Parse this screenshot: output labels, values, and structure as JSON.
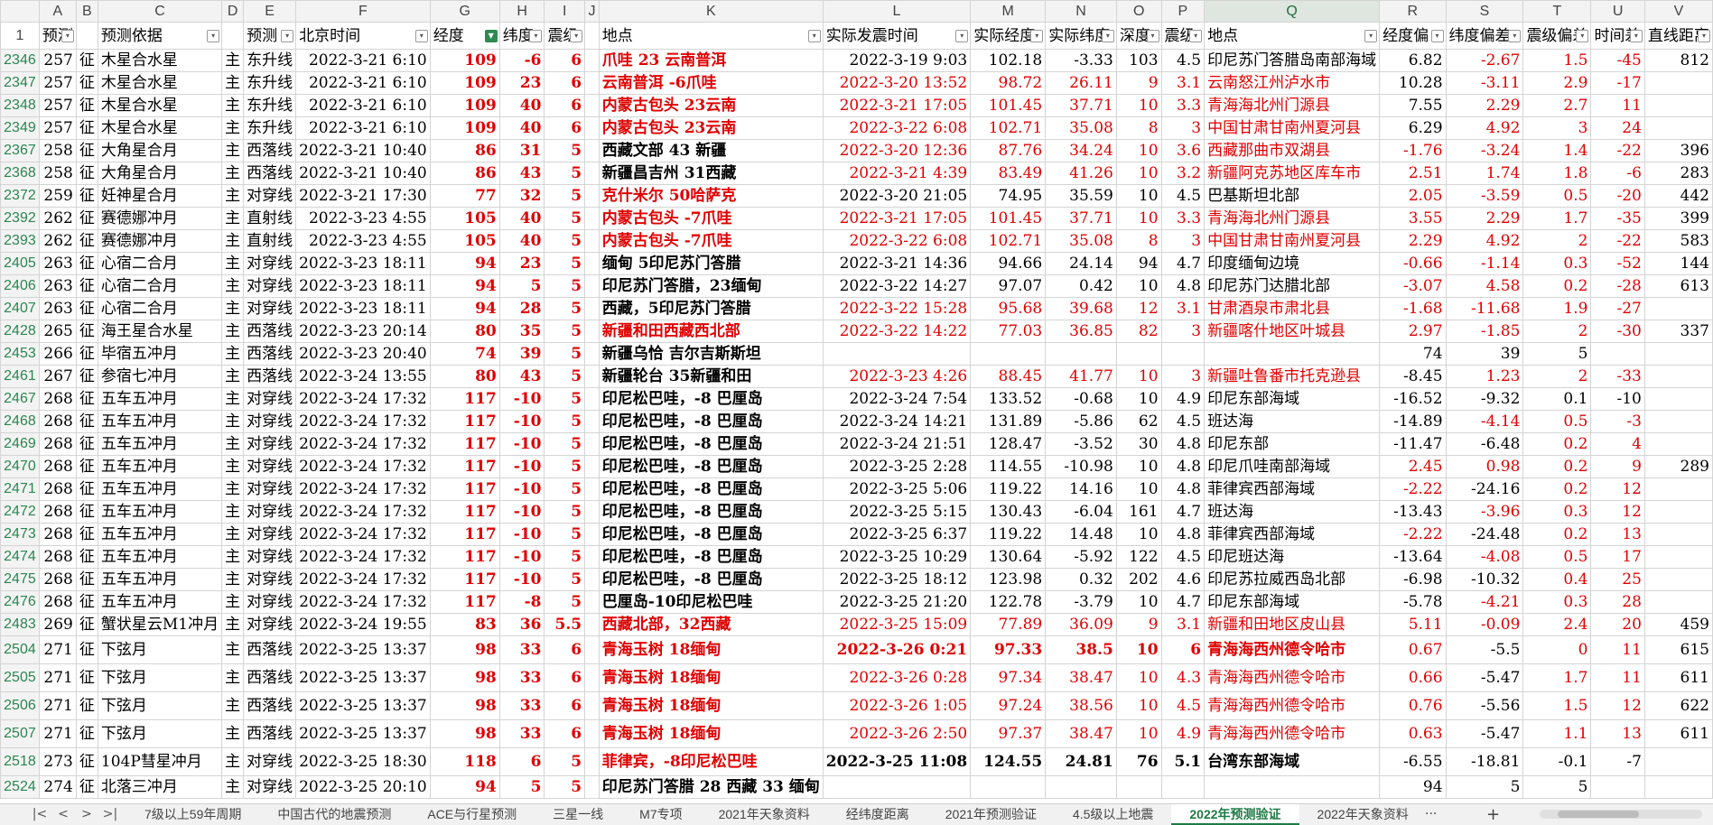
{
  "columns": [
    {
      "letter": "A",
      "header": "预测"
    },
    {
      "letter": "B",
      "header": ""
    },
    {
      "letter": "C",
      "header": "预测依据"
    },
    {
      "letter": "D",
      "header": ""
    },
    {
      "letter": "E",
      "header": "预测"
    },
    {
      "letter": "F",
      "header": "北京时间"
    },
    {
      "letter": "G",
      "header": "经度"
    },
    {
      "letter": "H",
      "header": "纬度"
    },
    {
      "letter": "I",
      "header": "震级"
    },
    {
      "letter": "J",
      "header": ""
    },
    {
      "letter": "K",
      "header": "地点"
    },
    {
      "letter": "L",
      "header": "实际发震时间"
    },
    {
      "letter": "M",
      "header": "实际经度"
    },
    {
      "letter": "N",
      "header": "实际纬度"
    },
    {
      "letter": "O",
      "header": "深度"
    },
    {
      "letter": "P",
      "header": "震级"
    },
    {
      "letter": "Q",
      "header": "地点"
    },
    {
      "letter": "R",
      "header": "经度偏"
    },
    {
      "letter": "S",
      "header": "纬度偏差"
    },
    {
      "letter": "T",
      "header": "震级偏差"
    },
    {
      "letter": "U",
      "header": "时间差"
    },
    {
      "letter": "V",
      "header": "直线距离"
    }
  ],
  "corner": "",
  "header_row": "1",
  "rows": [
    {
      "rn": "2346",
      "A": "257",
      "B": "征",
      "C": "木星合水星",
      "D": "主",
      "E": "东升线",
      "F": "2022-3-21  6:10",
      "G": "109",
      "H": "-6",
      "I": "6",
      "J": "",
      "K": "爪哇  23  云南普洱",
      "L": "2022-3-19  9:03",
      "M": "102.18",
      "N": "-3.33",
      "O": "103",
      "P": "4.5",
      "Q": "印尼苏门答腊岛南部海域",
      "R": "6.82",
      "S": "-2.67",
      "T": "1.5",
      "U": "-45",
      "V": "812",
      "kr": 1,
      "lr": 0,
      "qr": 0,
      "rr": 0,
      "sr": 1,
      "tr": 1,
      "ur": 1
    },
    {
      "rn": "2347",
      "A": "257",
      "B": "征",
      "C": "木星合水星",
      "D": "主",
      "E": "东升线",
      "F": "2022-3-21  6:10",
      "G": "109",
      "H": "23",
      "I": "6",
      "J": "",
      "K": "云南普洱  -6爪哇",
      "L": "2022-3-20  13:52",
      "M": "98.72",
      "N": "26.11",
      "O": "9",
      "P": "3.1",
      "Q": "云南怒江州泸水市",
      "R": "10.28",
      "S": "-3.11",
      "T": "2.9",
      "U": "-17",
      "V": "",
      "kr": 1,
      "lr": 1,
      "qr": 1,
      "rr": 0,
      "sr": 1,
      "tr": 1,
      "ur": 1
    },
    {
      "rn": "2348",
      "A": "257",
      "B": "征",
      "C": "木星合水星",
      "D": "主",
      "E": "东升线",
      "F": "2022-3-21  6:10",
      "G": "109",
      "H": "40",
      "I": "6",
      "J": "",
      "K": "内蒙古包头  23云南",
      "L": "2022-3-21  17:05",
      "M": "101.45",
      "N": "37.71",
      "O": "10",
      "P": "3.3",
      "Q": "青海海北州门源县",
      "R": "7.55",
      "S": "2.29",
      "T": "2.7",
      "U": "11",
      "V": "",
      "kr": 1,
      "lr": 1,
      "qr": 1,
      "rr": 0,
      "sr": 1,
      "tr": 1,
      "ur": 1
    },
    {
      "rn": "2349",
      "A": "257",
      "B": "征",
      "C": "木星合水星",
      "D": "主",
      "E": "东升线",
      "F": "2022-3-21  6:10",
      "G": "109",
      "H": "40",
      "I": "6",
      "J": "",
      "K": "内蒙古包头  23云南",
      "L": "2022-3-22  6:08",
      "M": "102.71",
      "N": "35.08",
      "O": "8",
      "P": "3",
      "Q": "中国甘肃甘南州夏河县",
      "R": "6.29",
      "S": "4.92",
      "T": "3",
      "U": "24",
      "V": "",
      "kr": 1,
      "lr": 1,
      "qr": 1,
      "rr": 0,
      "sr": 1,
      "tr": 1,
      "ur": 1
    },
    {
      "rn": "2367",
      "A": "258",
      "B": "征",
      "C": "大角星合月",
      "D": "主",
      "E": "西落线",
      "F": "2022-3-21  10:40",
      "G": "86",
      "H": "31",
      "I": "5",
      "J": "",
      "K": "西藏文部  43  新疆",
      "L": "2022-3-20  12:36",
      "M": "87.76",
      "N": "34.24",
      "O": "10",
      "P": "3.6",
      "Q": "西藏那曲市双湖县",
      "R": "-1.76",
      "S": "-3.24",
      "T": "1.4",
      "U": "-22",
      "V": "396",
      "kr": 0,
      "lr": 1,
      "qr": 1,
      "rr": 1,
      "sr": 1,
      "tr": 1,
      "ur": 1
    },
    {
      "rn": "2368",
      "A": "258",
      "B": "征",
      "C": "大角星合月",
      "D": "主",
      "E": "西落线",
      "F": "2022-3-21  10:40",
      "G": "86",
      "H": "43",
      "I": "5",
      "J": "",
      "K": "新疆昌吉州  31西藏",
      "L": "2022-3-21  4:39",
      "M": "83.49",
      "N": "41.26",
      "O": "10",
      "P": "3.2",
      "Q": "新疆阿克苏地区库车市",
      "R": "2.51",
      "S": "1.74",
      "T": "1.8",
      "U": "-6",
      "V": "283",
      "kr": 0,
      "lr": 1,
      "qr": 1,
      "rr": 1,
      "sr": 1,
      "tr": 1,
      "ur": 1
    },
    {
      "rn": "2372",
      "A": "259",
      "B": "征",
      "C": "妊神星合月",
      "D": "主",
      "E": "对穿线",
      "F": "2022-3-21  17:30",
      "G": "77",
      "H": "32",
      "I": "5",
      "J": "",
      "K": "克什米尔  50哈萨克",
      "L": "2022-3-20  21:05",
      "M": "74.95",
      "N": "35.59",
      "O": "10",
      "P": "4.5",
      "Q": "巴基斯坦北部",
      "R": "2.05",
      "S": "-3.59",
      "T": "0.5",
      "U": "-20",
      "V": "442",
      "kr": 1,
      "lr": 0,
      "qr": 0,
      "rr": 1,
      "sr": 1,
      "tr": 1,
      "ur": 1
    },
    {
      "rn": "2392",
      "A": "262",
      "B": "征",
      "C": "赛德娜冲月",
      "D": "主",
      "E": "直射线",
      "F": "2022-3-23  4:55",
      "G": "105",
      "H": "40",
      "I": "5",
      "J": "",
      "K": "内蒙古包头  -7爪哇",
      "L": "2022-3-21  17:05",
      "M": "101.45",
      "N": "37.71",
      "O": "10",
      "P": "3.3",
      "Q": "青海海北州门源县",
      "R": "3.55",
      "S": "2.29",
      "T": "1.7",
      "U": "-35",
      "V": "399",
      "kr": 1,
      "lr": 1,
      "qr": 1,
      "rr": 1,
      "sr": 1,
      "tr": 1,
      "ur": 1
    },
    {
      "rn": "2393",
      "A": "262",
      "B": "征",
      "C": "赛德娜冲月",
      "D": "主",
      "E": "直射线",
      "F": "2022-3-23  4:55",
      "G": "105",
      "H": "40",
      "I": "5",
      "J": "",
      "K": "内蒙古包头  -7爪哇",
      "L": "2022-3-22  6:08",
      "M": "102.71",
      "N": "35.08",
      "O": "8",
      "P": "3",
      "Q": "中国甘肃甘南州夏河县",
      "R": "2.29",
      "S": "4.92",
      "T": "2",
      "U": "-22",
      "V": "583",
      "kr": 1,
      "lr": 1,
      "qr": 1,
      "rr": 1,
      "sr": 1,
      "tr": 1,
      "ur": 1
    },
    {
      "rn": "2405",
      "A": "263",
      "B": "征",
      "C": "心宿二合月",
      "D": "主",
      "E": "对穿线",
      "F": "2022-3-23  18:11",
      "G": "94",
      "H": "23",
      "I": "5",
      "J": "",
      "K": "缅甸  5印尼苏门答腊",
      "L": "2022-3-21  14:36",
      "M": "94.66",
      "N": "24.14",
      "O": "94",
      "P": "4.7",
      "Q": "印度缅甸边境",
      "R": "-0.66",
      "S": "-1.14",
      "T": "0.3",
      "U": "-52",
      "V": "144",
      "kr": 0,
      "lr": 0,
      "qr": 0,
      "rr": 1,
      "sr": 1,
      "tr": 1,
      "ur": 1
    },
    {
      "rn": "2406",
      "A": "263",
      "B": "征",
      "C": "心宿二合月",
      "D": "主",
      "E": "对穿线",
      "F": "2022-3-23  18:11",
      "G": "94",
      "H": "5",
      "I": "5",
      "J": "",
      "K": "印尼苏门答腊，23缅甸",
      "L": "2022-3-22  14:27",
      "M": "97.07",
      "N": "0.42",
      "O": "10",
      "P": "4.8",
      "Q": "印尼苏门达腊北部",
      "R": "-3.07",
      "S": "4.58",
      "T": "0.2",
      "U": "-28",
      "V": "613",
      "kr": 0,
      "lr": 0,
      "qr": 0,
      "rr": 1,
      "sr": 1,
      "tr": 1,
      "ur": 1
    },
    {
      "rn": "2407",
      "A": "263",
      "B": "征",
      "C": "心宿二合月",
      "D": "主",
      "E": "对穿线",
      "F": "2022-3-23  18:11",
      "G": "94",
      "H": "28",
      "I": "5",
      "J": "",
      "K": "西藏，5印尼苏门答腊",
      "L": "2022-3-22  15:28",
      "M": "95.68",
      "N": "39.68",
      "O": "12",
      "P": "3.1",
      "Q": "甘肃酒泉市肃北县",
      "R": "-1.68",
      "S": "-11.68",
      "T": "1.9",
      "U": "-27",
      "V": "",
      "kr": 0,
      "lr": 1,
      "qr": 1,
      "rr": 1,
      "sr": 1,
      "tr": 1,
      "ur": 1
    },
    {
      "rn": "2428",
      "A": "265",
      "B": "征",
      "C": "海王星合水星",
      "D": "主",
      "E": "西落线",
      "F": "2022-3-23  20:14",
      "G": "80",
      "H": "35",
      "I": "5",
      "J": "",
      "K": "新疆和田西藏西北部",
      "L": "2022-3-22  14:22",
      "M": "77.03",
      "N": "36.85",
      "O": "82",
      "P": "3",
      "Q": "新疆喀什地区叶城县",
      "R": "2.97",
      "S": "-1.85",
      "T": "2",
      "U": "-30",
      "V": "337",
      "kr": 1,
      "lr": 1,
      "qr": 1,
      "rr": 1,
      "sr": 1,
      "tr": 1,
      "ur": 1
    },
    {
      "rn": "2453",
      "A": "266",
      "B": "征",
      "C": "毕宿五冲月",
      "D": "主",
      "E": "西落线",
      "F": "2022-3-23  20:40",
      "G": "74",
      "H": "39",
      "I": "5",
      "J": "",
      "K": "新疆乌恰  吉尔吉斯斯坦",
      "L": "",
      "M": "",
      "N": "",
      "O": "",
      "P": "",
      "Q": "",
      "R": "74",
      "S": "39",
      "T": "5",
      "U": "",
      "V": "",
      "kr": 0,
      "lr": 0,
      "qr": 0,
      "rr": 0,
      "sr": 0,
      "tr": 0,
      "ur": 0
    },
    {
      "rn": "2461",
      "A": "267",
      "B": "征",
      "C": "参宿七冲月",
      "D": "主",
      "E": "西落线",
      "F": "2022-3-24  13:55",
      "G": "80",
      "H": "43",
      "I": "5",
      "J": "",
      "K": "新疆轮台  35新疆和田",
      "L": "2022-3-23  4:26",
      "M": "88.45",
      "N": "41.77",
      "O": "10",
      "P": "3",
      "Q": "新疆吐鲁番市托克逊县",
      "R": "-8.45",
      "S": "1.23",
      "T": "2",
      "U": "-33",
      "V": "",
      "kr": 0,
      "lr": 1,
      "qr": 1,
      "rr": 0,
      "sr": 1,
      "tr": 1,
      "ur": 1
    },
    {
      "rn": "2467",
      "A": "268",
      "B": "征",
      "C": "五车五冲月",
      "D": "主",
      "E": "对穿线",
      "F": "2022-3-24  17:32",
      "G": "117",
      "H": "-10",
      "I": "5",
      "J": "",
      "K": "印尼松巴哇，-8  巴厘岛",
      "L": "2022-3-24  7:54",
      "M": "133.52",
      "N": "-0.68",
      "O": "10",
      "P": "4.9",
      "Q": "印尼东部海域",
      "R": "-16.52",
      "S": "-9.32",
      "T": "0.1",
      "U": "-10",
      "V": "",
      "kr": 0,
      "lr": 0,
      "qr": 0,
      "rr": 0,
      "sr": 0,
      "tr": 0,
      "ur": 0
    },
    {
      "rn": "2468",
      "A": "268",
      "B": "征",
      "C": "五车五冲月",
      "D": "主",
      "E": "对穿线",
      "F": "2022-3-24  17:32",
      "G": "117",
      "H": "-10",
      "I": "5",
      "J": "",
      "K": "印尼松巴哇，-8  巴厘岛",
      "L": "2022-3-24  14:21",
      "M": "131.89",
      "N": "-5.86",
      "O": "62",
      "P": "4.5",
      "Q": "班达海",
      "R": "-14.89",
      "S": "-4.14",
      "T": "0.5",
      "U": "-3",
      "V": "",
      "kr": 0,
      "lr": 0,
      "qr": 0,
      "rr": 0,
      "sr": 1,
      "tr": 1,
      "ur": 1
    },
    {
      "rn": "2469",
      "A": "268",
      "B": "征",
      "C": "五车五冲月",
      "D": "主",
      "E": "对穿线",
      "F": "2022-3-24  17:32",
      "G": "117",
      "H": "-10",
      "I": "5",
      "J": "",
      "K": "印尼松巴哇，-8  巴厘岛",
      "L": "2022-3-24  21:51",
      "M": "128.47",
      "N": "-3.52",
      "O": "30",
      "P": "4.8",
      "Q": "印尼东部",
      "R": "-11.47",
      "S": "-6.48",
      "T": "0.2",
      "U": "4",
      "V": "",
      "kr": 0,
      "lr": 0,
      "qr": 0,
      "rr": 0,
      "sr": 0,
      "tr": 1,
      "ur": 1
    },
    {
      "rn": "2470",
      "A": "268",
      "B": "征",
      "C": "五车五冲月",
      "D": "主",
      "E": "对穿线",
      "F": "2022-3-24  17:32",
      "G": "117",
      "H": "-10",
      "I": "5",
      "J": "",
      "K": "印尼松巴哇，-8  巴厘岛",
      "L": "2022-3-25  2:28",
      "M": "114.55",
      "N": "-10.98",
      "O": "10",
      "P": "4.8",
      "Q": "印尼爪哇南部海域",
      "R": "2.45",
      "S": "0.98",
      "T": "0.2",
      "U": "9",
      "V": "289",
      "kr": 0,
      "lr": 0,
      "qr": 0,
      "rr": 1,
      "sr": 1,
      "tr": 1,
      "ur": 1
    },
    {
      "rn": "2471",
      "A": "268",
      "B": "征",
      "C": "五车五冲月",
      "D": "主",
      "E": "对穿线",
      "F": "2022-3-24  17:32",
      "G": "117",
      "H": "-10",
      "I": "5",
      "J": "",
      "K": "印尼松巴哇，-8  巴厘岛",
      "L": "2022-3-25  5:06",
      "M": "119.22",
      "N": "14.16",
      "O": "10",
      "P": "4.8",
      "Q": "菲律宾西部海域",
      "R": "-2.22",
      "S": "-24.16",
      "T": "0.2",
      "U": "12",
      "V": "",
      "kr": 0,
      "lr": 0,
      "qr": 0,
      "rr": 1,
      "sr": 0,
      "tr": 1,
      "ur": 1
    },
    {
      "rn": "2472",
      "A": "268",
      "B": "征",
      "C": "五车五冲月",
      "D": "主",
      "E": "对穿线",
      "F": "2022-3-24  17:32",
      "G": "117",
      "H": "-10",
      "I": "5",
      "J": "",
      "K": "印尼松巴哇，-8  巴厘岛",
      "L": "2022-3-25  5:15",
      "M": "130.43",
      "N": "-6.04",
      "O": "161",
      "P": "4.7",
      "Q": "班达海",
      "R": "-13.43",
      "S": "-3.96",
      "T": "0.3",
      "U": "12",
      "V": "",
      "kr": 0,
      "lr": 0,
      "qr": 0,
      "rr": 0,
      "sr": 1,
      "tr": 1,
      "ur": 1
    },
    {
      "rn": "2473",
      "A": "268",
      "B": "征",
      "C": "五车五冲月",
      "D": "主",
      "E": "对穿线",
      "F": "2022-3-24  17:32",
      "G": "117",
      "H": "-10",
      "I": "5",
      "J": "",
      "K": "印尼松巴哇，-8  巴厘岛",
      "L": "2022-3-25  6:37",
      "M": "119.22",
      "N": "14.48",
      "O": "10",
      "P": "4.8",
      "Q": "菲律宾西部海域",
      "R": "-2.22",
      "S": "-24.48",
      "T": "0.2",
      "U": "13",
      "V": "",
      "kr": 0,
      "lr": 0,
      "qr": 0,
      "rr": 1,
      "sr": 0,
      "tr": 1,
      "ur": 1
    },
    {
      "rn": "2474",
      "A": "268",
      "B": "征",
      "C": "五车五冲月",
      "D": "主",
      "E": "对穿线",
      "F": "2022-3-24  17:32",
      "G": "117",
      "H": "-10",
      "I": "5",
      "J": "",
      "K": "印尼松巴哇，-8  巴厘岛",
      "L": "2022-3-25  10:29",
      "M": "130.64",
      "N": "-5.92",
      "O": "122",
      "P": "4.5",
      "Q": "印尼班达海",
      "R": "-13.64",
      "S": "-4.08",
      "T": "0.5",
      "U": "17",
      "V": "",
      "kr": 0,
      "lr": 0,
      "qr": 0,
      "rr": 0,
      "sr": 1,
      "tr": 1,
      "ur": 1
    },
    {
      "rn": "2475",
      "A": "268",
      "B": "征",
      "C": "五车五冲月",
      "D": "主",
      "E": "对穿线",
      "F": "2022-3-24  17:32",
      "G": "117",
      "H": "-10",
      "I": "5",
      "J": "",
      "K": "印尼松巴哇，-8  巴厘岛",
      "L": "2022-3-25  18:12",
      "M": "123.98",
      "N": "0.32",
      "O": "202",
      "P": "4.6",
      "Q": "印尼苏拉威西岛北部",
      "R": "-6.98",
      "S": "-10.32",
      "T": "0.4",
      "U": "25",
      "V": "",
      "kr": 0,
      "lr": 0,
      "qr": 0,
      "rr": 0,
      "sr": 0,
      "tr": 1,
      "ur": 1
    },
    {
      "rn": "2476",
      "A": "268",
      "B": "征",
      "C": "五车五冲月",
      "D": "主",
      "E": "对穿线",
      "F": "2022-3-24  17:32",
      "G": "117",
      "H": "-8",
      "I": "5",
      "J": "",
      "K": "巴厘岛-10印尼松巴哇",
      "L": "2022-3-25  21:20",
      "M": "122.78",
      "N": "-3.79",
      "O": "10",
      "P": "4.7",
      "Q": "印尼东部海域",
      "R": "-5.78",
      "S": "-4.21",
      "T": "0.3",
      "U": "28",
      "V": "",
      "kr": 0,
      "lr": 0,
      "qr": 0,
      "rr": 0,
      "sr": 1,
      "tr": 1,
      "ur": 1
    },
    {
      "rn": "2483",
      "A": "269",
      "B": "征",
      "C": "蟹状星云M1冲月",
      "D": "主",
      "E": "对穿线",
      "F": "2022-3-24  19:55",
      "G": "83",
      "H": "36",
      "I": "5.5",
      "J": "",
      "K": "西藏北部，32西藏",
      "L": "2022-3-25  15:09",
      "M": "77.89",
      "N": "36.09",
      "O": "9",
      "P": "3.1",
      "Q": "新疆和田地区皮山县",
      "R": "5.11",
      "S": "-0.09",
      "T": "2.4",
      "U": "20",
      "V": "459",
      "kr": 1,
      "lr": 1,
      "qr": 1,
      "rr": 1,
      "sr": 1,
      "tr": 1,
      "ur": 1
    },
    {
      "rn": "2504",
      "A": "271",
      "B": "征",
      "C": "下弦月",
      "D": "主",
      "E": "西落线",
      "F": "2022-3-25  13:37",
      "G": "98",
      "H": "33",
      "I": "6",
      "J": "",
      "K": "青海玉树  18缅甸",
      "L": "2022-3-26  0:21",
      "M": "97.33",
      "N": "38.5",
      "O": "10",
      "P": "6",
      "Q": "青海海西州德令哈市",
      "R": "0.67",
      "S": "-5.5",
      "T": "0",
      "U": "11",
      "V": "615",
      "tall": 1,
      "kr": 1,
      "lr": 1,
      "qr": 1,
      "rr": 1,
      "sr": 0,
      "tr": 1,
      "ur": 1,
      "bold": 1
    },
    {
      "rn": "2505",
      "A": "271",
      "B": "征",
      "C": "下弦月",
      "D": "主",
      "E": "西落线",
      "F": "2022-3-25  13:37",
      "G": "98",
      "H": "33",
      "I": "6",
      "J": "",
      "K": "青海玉树  18缅甸",
      "L": "2022-3-26  0:28",
      "M": "97.34",
      "N": "38.47",
      "O": "10",
      "P": "4.3",
      "Q": "青海海西州德令哈市",
      "R": "0.66",
      "S": "-5.47",
      "T": "1.7",
      "U": "11",
      "V": "611",
      "tall": 1,
      "kr": 1,
      "lr": 1,
      "qr": 1,
      "rr": 1,
      "sr": 0,
      "tr": 1,
      "ur": 1
    },
    {
      "rn": "2506",
      "A": "271",
      "B": "征",
      "C": "下弦月",
      "D": "主",
      "E": "西落线",
      "F": "2022-3-25  13:37",
      "G": "98",
      "H": "33",
      "I": "6",
      "J": "",
      "K": "青海玉树  18缅甸",
      "L": "2022-3-26  1:05",
      "M": "97.24",
      "N": "38.56",
      "O": "10",
      "P": "4.5",
      "Q": "青海海西州德令哈市",
      "R": "0.76",
      "S": "-5.56",
      "T": "1.5",
      "U": "12",
      "V": "622",
      "tall": 1,
      "kr": 1,
      "lr": 1,
      "qr": 1,
      "rr": 1,
      "sr": 0,
      "tr": 1,
      "ur": 1
    },
    {
      "rn": "2507",
      "A": "271",
      "B": "征",
      "C": "下弦月",
      "D": "主",
      "E": "西落线",
      "F": "2022-3-25  13:37",
      "G": "98",
      "H": "33",
      "I": "6",
      "J": "",
      "K": "青海玉树  18缅甸",
      "L": "2022-3-26  2:50",
      "M": "97.37",
      "N": "38.47",
      "O": "10",
      "P": "4.9",
      "Q": "青海海西州德令哈市",
      "R": "0.63",
      "S": "-5.47",
      "T": "1.1",
      "U": "13",
      "V": "611",
      "tall": 1,
      "kr": 1,
      "lr": 1,
      "qr": 1,
      "rr": 1,
      "sr": 0,
      "tr": 1,
      "ur": 1
    },
    {
      "rn": "2518",
      "A": "273",
      "B": "征",
      "C": "104P彗星冲月",
      "D": "主",
      "E": "对穿线",
      "F": "2022-3-25  18:30",
      "G": "118",
      "H": "6",
      "I": "5",
      "J": "",
      "K": "菲律宾，-8印尼松巴哇",
      "L": "2022-3-25  11:08",
      "M": "124.55",
      "N": "24.81",
      "O": "76",
      "P": "5.1",
      "Q": "台湾东部海域",
      "R": "-6.55",
      "S": "-18.81",
      "T": "-0.1",
      "U": "-7",
      "V": "",
      "tall": 1,
      "kr": 1,
      "lr": 0,
      "qr": 0,
      "rr": 0,
      "sr": 0,
      "tr": 0,
      "ur": 0,
      "bold": 1
    },
    {
      "rn": "2524",
      "A": "274",
      "B": "征",
      "C": "北落三冲月",
      "D": "主",
      "E": "对穿线",
      "F": "2022-3-25  20:10",
      "G": "94",
      "H": "5",
      "I": "5",
      "J": "",
      "K": "印尼苏门答腊  28  西藏  33  缅甸",
      "L": "",
      "M": "",
      "N": "",
      "O": "",
      "P": "",
      "Q": "",
      "R": "94",
      "S": "5",
      "T": "5",
      "U": "",
      "V": "",
      "kr": 0,
      "lr": 0,
      "qr": 0,
      "rr": 0,
      "sr": 0,
      "tr": 0,
      "ur": 0
    }
  ],
  "tabs": [
    "7级以上59年周期",
    "中国古代的地震预测",
    "ACE与行星预测",
    "三星一线",
    "M7专项",
    "2021年天象资料",
    "经纬度距离",
    "2021年预测验证",
    "4.5级以上地震",
    "2022年预测验证",
    "2022年天象资料"
  ],
  "active_tab": "2022年预测验证",
  "nav": {
    "first": "|<",
    "prev": "<",
    "next": ">",
    "last": ">|",
    "more": "···",
    "add": "+"
  },
  "colors": {
    "accent": "#1f7a45",
    "red": "#e00000"
  }
}
